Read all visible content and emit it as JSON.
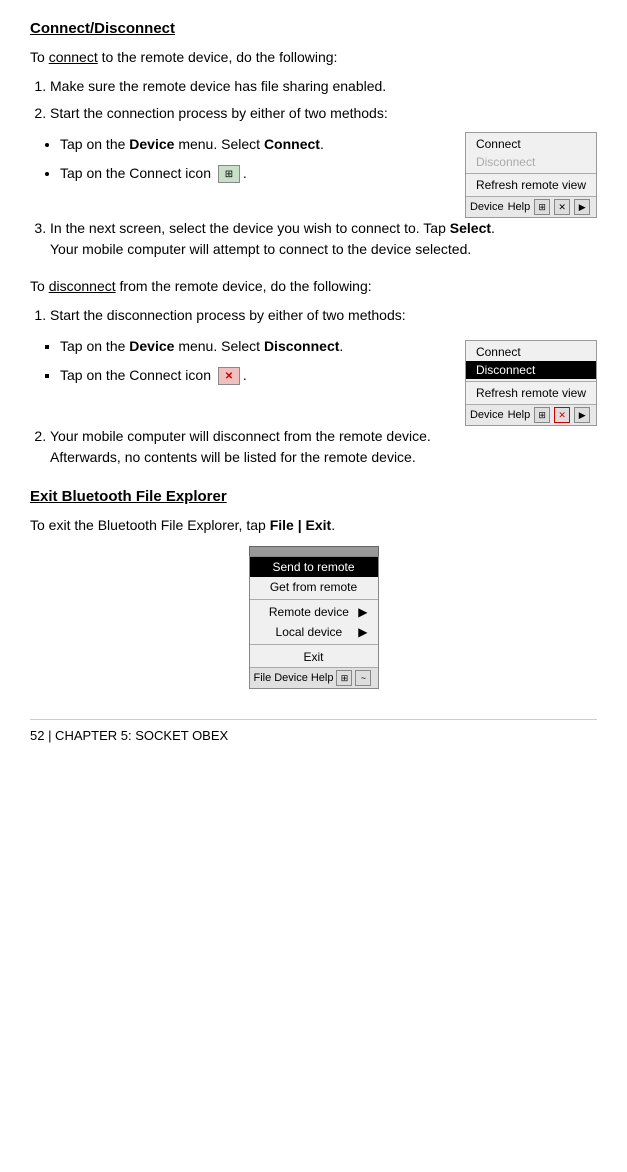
{
  "page": {
    "title": "Connect/Disconnect",
    "connect_section": {
      "heading": "Connect/Disconnect",
      "intro": "To connect to the remote device, do the following:",
      "steps": [
        "Make sure the remote device has file sharing enabled.",
        "Start the connection process by either of two methods:"
      ],
      "bullet1": "Tap on the ",
      "bullet1_bold": "Device",
      "bullet1_rest": " menu. Select ",
      "bullet1_select": "Connect",
      "bullet1_end": ".",
      "bullet2_pre": "Tap on the Connect icon",
      "bullet2_end": ".",
      "step3_pre": "In the next screen, select the device you wish to connect to. Tap ",
      "step3_bold": "Select",
      "step3_end": ".",
      "step3_line2": "Your mobile computer will attempt to connect to the device selected.",
      "connect_menu": {
        "items": [
          "Connect",
          "Disconnect",
          "Refresh remote view"
        ],
        "selected": null,
        "grayed": [
          "Disconnect"
        ],
        "toolbar_labels": [
          "Device",
          "Help"
        ]
      }
    },
    "disconnect_section": {
      "intro": "To disconnect from the remote device, do the following:",
      "steps": [
        "Start the disconnection process by either of two methods:"
      ],
      "bullet1_pre": "Tap on the ",
      "bullet1_bold": "Device",
      "bullet1_rest": " menu. Select ",
      "bullet1_select": "Disconnect",
      "bullet1_end": ".",
      "bullet2_pre": "Tap on the Connect icon",
      "bullet2_end": ".",
      "step2_pre": "Your mobile computer will disconnect from the remote device.",
      "step2_line2": "Afterwards, no contents will be listed for the remote device.",
      "disconnect_menu": {
        "items": [
          "Connect",
          "Disconnect",
          "Refresh remote view"
        ],
        "selected": "Disconnect",
        "toolbar_labels": [
          "Device",
          "Help"
        ]
      }
    },
    "exit_section": {
      "heading": "Exit Bluetooth File Explorer",
      "intro_pre": "To exit the Bluetooth File Explorer, tap ",
      "intro_bold": "File | Exit",
      "intro_end": ".",
      "file_menu": {
        "items": [
          "Send to remote",
          "Get from remote",
          "Remote device",
          "Local device",
          "Exit"
        ],
        "arrows": [
          "Remote device",
          "Local device"
        ],
        "selected": "Send to remote",
        "toolbar_labels": [
          "File",
          "Device",
          "Help"
        ]
      }
    },
    "footer": {
      "text": "52  | CHAPTER 5: SOCKET OBEX"
    }
  }
}
